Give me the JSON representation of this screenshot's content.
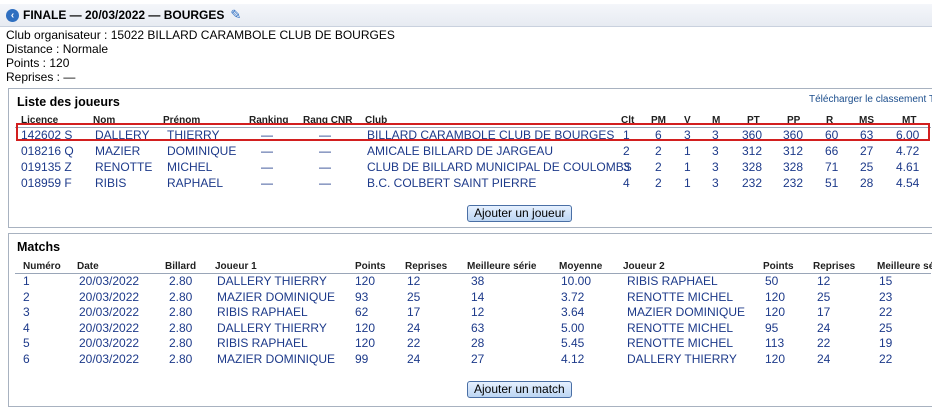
{
  "header": {
    "title": "FINALE — 20/03/2022 — BOURGES",
    "back_icon": "back-arrow-icon",
    "edit_icon": "edit-icon"
  },
  "info": {
    "club": "Club organisateur : 15022 BILLARD CARAMBOLE CLUB DE BOURGES",
    "distance": "Distance : Normale",
    "points": "Points : 120",
    "reprises": "Reprises : —"
  },
  "players_panel": {
    "title": "Liste des joueurs",
    "download_link": "Télécharger le classement",
    "download_link2": "T",
    "columns": [
      "Licence",
      "Nom",
      "Prénom",
      "Ranking",
      "Rang CNR",
      "Club",
      "Clt",
      "PM",
      "V",
      "M",
      "PT",
      "PP",
      "R",
      "MS",
      "MT"
    ],
    "rows": [
      [
        "142602 S",
        "DALLERY",
        "THIERRY",
        "—",
        "—",
        "BILLARD CARAMBOLE CLUB DE BOURGES",
        "1",
        "6",
        "3",
        "3",
        "360",
        "360",
        "60",
        "63",
        "6.00"
      ],
      [
        "018216 Q",
        "MAZIER",
        "DOMINIQUE",
        "—",
        "—",
        "AMICALE BILLARD DE JARGEAU",
        "2",
        "2",
        "1",
        "3",
        "312",
        "312",
        "66",
        "27",
        "4.72"
      ],
      [
        "019135 Z",
        "RENOTTE",
        "MICHEL",
        "—",
        "—",
        "CLUB DE BILLARD MUNICIPAL DE COULOMBS",
        "3",
        "2",
        "1",
        "3",
        "328",
        "328",
        "71",
        "25",
        "4.61"
      ],
      [
        "018959 F",
        "RIBIS",
        "RAPHAEL",
        "—",
        "—",
        "B.C. COLBERT SAINT PIERRE",
        "4",
        "2",
        "1",
        "3",
        "232",
        "232",
        "51",
        "28",
        "4.54"
      ]
    ],
    "add_button": "Ajouter un joueur"
  },
  "matches_panel": {
    "title": "Matchs",
    "columns": [
      "Numéro",
      "Date",
      "Billard",
      "Joueur 1",
      "Points",
      "Reprises",
      "Meilleure série",
      "Moyenne",
      "Joueur 2",
      "Points",
      "Reprises",
      "Meilleure série"
    ],
    "rows": [
      [
        "1",
        "20/03/2022",
        "2.80",
        "DALLERY THIERRY",
        "120",
        "12",
        "38",
        "10.00",
        "RIBIS RAPHAEL",
        "50",
        "12",
        "15"
      ],
      [
        "2",
        "20/03/2022",
        "2.80",
        "MAZIER DOMINIQUE",
        "93",
        "25",
        "14",
        "3.72",
        "RENOTTE MICHEL",
        "120",
        "25",
        "23"
      ],
      [
        "3",
        "20/03/2022",
        "2.80",
        "RIBIS RAPHAEL",
        "62",
        "17",
        "12",
        "3.64",
        "MAZIER DOMINIQUE",
        "120",
        "17",
        "22"
      ],
      [
        "4",
        "20/03/2022",
        "2.80",
        "DALLERY THIERRY",
        "120",
        "24",
        "63",
        "5.00",
        "RENOTTE MICHEL",
        "95",
        "24",
        "25"
      ],
      [
        "5",
        "20/03/2022",
        "2.80",
        "RIBIS RAPHAEL",
        "120",
        "22",
        "28",
        "5.45",
        "RENOTTE MICHEL",
        "113",
        "22",
        "19"
      ],
      [
        "6",
        "20/03/2022",
        "2.80",
        "MAZIER DOMINIQUE",
        "99",
        "24",
        "27",
        "4.12",
        "DALLERY THIERRY",
        "120",
        "24",
        "22"
      ]
    ],
    "add_button": "Ajouter un match"
  },
  "colors": {
    "link": "#1d3a8a",
    "highlight": "#d21f1f",
    "accent": "#2f6fc0"
  }
}
